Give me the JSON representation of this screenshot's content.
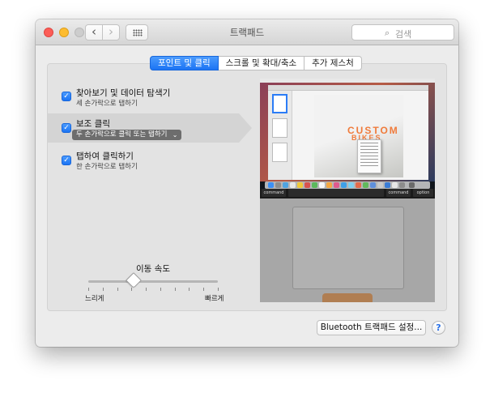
{
  "window": {
    "title": "트랙패드"
  },
  "toolbar": {
    "back_symbol": "‹",
    "forward_symbol": "›",
    "grid_icon": "grid-icon"
  },
  "search": {
    "placeholder": "검색",
    "icon": "magnifier"
  },
  "tabs": [
    {
      "label": "포인트 및 클릭",
      "selected": true
    },
    {
      "label": "스크롤 및 확대/축소",
      "selected": false
    },
    {
      "label": "추가 제스처",
      "selected": false
    }
  ],
  "options": [
    {
      "title": "찾아보기 및 데이터 탐색기",
      "subtitle": "세 손가락으로 탭하기",
      "checked": true
    },
    {
      "title": "보조 클릭",
      "popup_value": "두 손가락으로 클릭 또는 탭하기",
      "checked": true,
      "highlighted": true
    },
    {
      "title": "탭하여 클릭하기",
      "subtitle": "한 손가락으로 탭하기",
      "checked": true
    }
  ],
  "tracking_speed": {
    "title": "이동 속도",
    "slow_label": "느리게",
    "fast_label": "빠르게",
    "ticks": 10,
    "value_fraction": 0.35
  },
  "preview": {
    "headline_1": "CUSTOM",
    "headline_2": "BIKES",
    "key_left": "command",
    "key_right_1": "command",
    "key_right_2": "option"
  },
  "footer": {
    "bluetooth_button": "Bluetooth 트랙패드 설정...",
    "help_symbol": "?"
  },
  "colors": {
    "accent": "#1c74f4",
    "close": "#fc5d57",
    "minimize": "#fdbc2f",
    "popup_bg": "#6d6d6d"
  }
}
